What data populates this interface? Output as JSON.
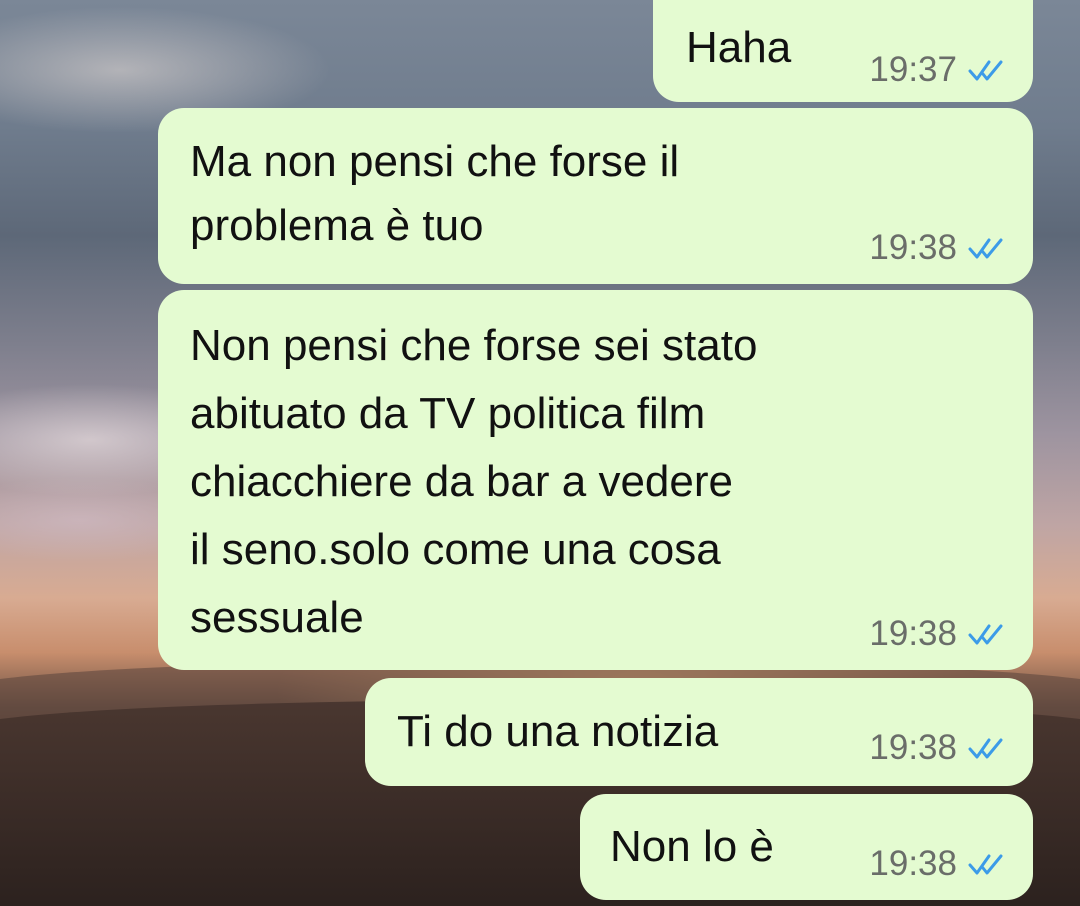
{
  "messages": [
    {
      "text": "Haha",
      "time": "19:37",
      "status": "read-double-check-icon"
    },
    {
      "text": "Ma non pensi che forse il\nproblema è tuo",
      "time": "19:38",
      "status": "read-double-check-icon"
    },
    {
      "text": "Non pensi che forse sei stato\nabituato da TV politica film\nchiacchiere da bar a vedere\nil seno.solo come una cosa\nsessuale",
      "time": "19:38",
      "status": "read-double-check-icon"
    },
    {
      "text": "Ti do una notizia",
      "time": "19:38",
      "status": "read-double-check-icon"
    },
    {
      "text": "Non lo è",
      "time": "19:38",
      "status": "read-double-check-icon"
    }
  ],
  "colors": {
    "outgoing_bubble": "#e4fbd1",
    "read_tick": "#3c9be8",
    "timestamp": "#6a6d69"
  }
}
